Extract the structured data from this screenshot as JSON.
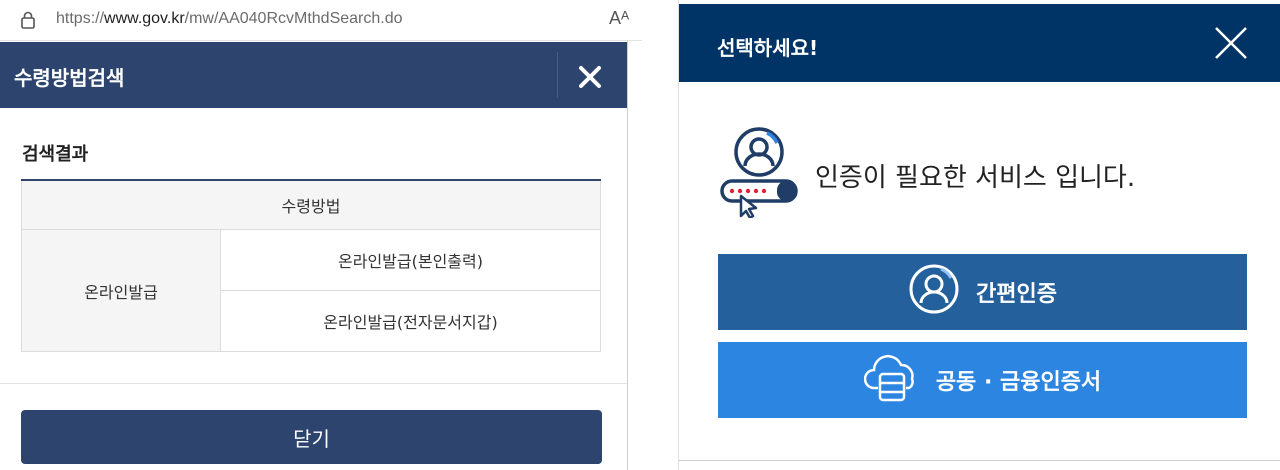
{
  "browser": {
    "url_prefix": "https://",
    "url_domain": "www.gov.kr",
    "url_path": "/mw/AA040RcvMthdSearch.do",
    "read_aloud": "Aᴬ"
  },
  "left_dialog": {
    "title": "수령방법검색",
    "section_title": "검색결과",
    "table": {
      "header": "수령방법",
      "row_header": "온라인발급",
      "rows": [
        "온라인발급(본인출력)",
        "온라인발급(전자문서지갑)"
      ]
    },
    "close_button": "닫기"
  },
  "right_dialog": {
    "title": "선택하세요!",
    "message": "인증이 필요한 서비스 입니다.",
    "buttons": {
      "simple_auth": "간편인증",
      "cert_auth": "공동 · 금융인증서"
    }
  },
  "colors": {
    "left_header": "#2d446f",
    "right_header": "#003466",
    "simple_auth": "#23609c",
    "cert_auth": "#2d85e2"
  }
}
